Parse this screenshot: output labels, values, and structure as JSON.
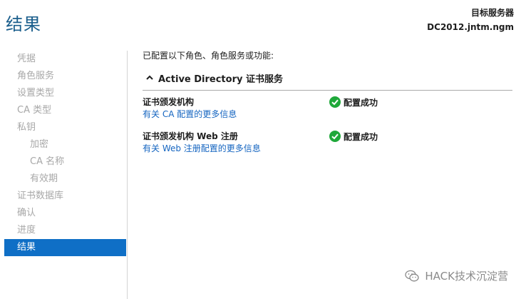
{
  "page": {
    "title": "结果"
  },
  "target_server": {
    "label": "目标服务器",
    "name": "DC2012.jntm.ngm"
  },
  "sidebar": {
    "items": [
      {
        "label": "凭据",
        "level": 0,
        "active": false
      },
      {
        "label": "角色服务",
        "level": 0,
        "active": false
      },
      {
        "label": "设置类型",
        "level": 0,
        "active": false
      },
      {
        "label": "CA 类型",
        "level": 0,
        "active": false
      },
      {
        "label": "私钥",
        "level": 0,
        "active": false
      },
      {
        "label": "加密",
        "level": 1,
        "active": false
      },
      {
        "label": "CA 名称",
        "level": 1,
        "active": false
      },
      {
        "label": "有效期",
        "level": 1,
        "active": false
      },
      {
        "label": "证书数据库",
        "level": 0,
        "active": false
      },
      {
        "label": "确认",
        "level": 0,
        "active": false
      },
      {
        "label": "进度",
        "level": 0,
        "active": false
      },
      {
        "label": "结果",
        "level": 0,
        "active": true
      }
    ]
  },
  "main": {
    "intro": "已配置以下角色、角色服务或功能:",
    "section": {
      "title": "Active Directory 证书服务",
      "icon": "chevron-up-icon"
    },
    "results": [
      {
        "name": "证书颁发机构",
        "link": "有关 CA 配置的更多信息",
        "status": "配置成功",
        "status_icon": "check-circle-icon"
      },
      {
        "name": "证书颁发机构 Web 注册",
        "link": "有关 Web 注册配置的更多信息",
        "status": "配置成功",
        "status_icon": "check-circle-icon"
      }
    ]
  },
  "watermark": {
    "text": "HACK技术沉淀营",
    "icon": "wechat-icon"
  },
  "colors": {
    "title": "#1a5e8c",
    "active_nav": "#0f6fc6",
    "link": "#1565c0",
    "success": "#1fa83a",
    "inactive_nav": "#a8a8a8"
  }
}
